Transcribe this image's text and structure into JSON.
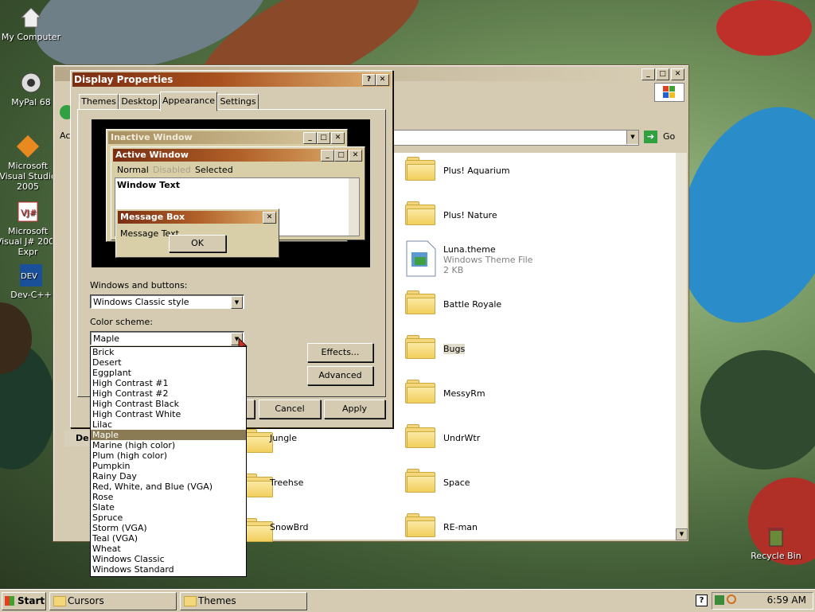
{
  "desktop": {
    "icons": [
      {
        "label": "My Computer"
      },
      {
        "label": "MyPal 68"
      },
      {
        "label": "Microsoft Visual Studio 2005"
      },
      {
        "label": "Microsoft Visual J# 2005 Expr"
      },
      {
        "label": "Dev-C++"
      },
      {
        "label": "Recycle Bin"
      }
    ]
  },
  "explorer": {
    "address_label": "Ac",
    "go_label": "Go",
    "sidebar_header": "De",
    "items": [
      {
        "label": "Plus! Aquarium",
        "type": "folder"
      },
      {
        "label": "Plus! Nature",
        "type": "folder"
      },
      {
        "label": "Luna.theme",
        "type": "file",
        "subtype": "Windows Theme File",
        "size": "2 KB"
      },
      {
        "label": "Battle Royale",
        "type": "folder"
      },
      {
        "label": "Bugs",
        "type": "folder"
      },
      {
        "label": "MessyRm",
        "type": "folder"
      },
      {
        "label": "Jungle",
        "type": "folder"
      },
      {
        "label": "UndrWtr",
        "type": "folder"
      },
      {
        "label": "Treehse",
        "type": "folder"
      },
      {
        "label": "Space",
        "type": "folder"
      },
      {
        "label": "SnowBrd",
        "type": "folder"
      },
      {
        "label": "RE-man",
        "type": "folder"
      }
    ]
  },
  "dialog": {
    "title": "Display Properties",
    "help_btn": "?",
    "close_btn": "✕",
    "tabs": [
      "Themes",
      "Desktop",
      "Appearance",
      "Settings"
    ],
    "active_tab": "Appearance",
    "preview": {
      "inactive_title": "Inactive Window",
      "active_title": "Active Window",
      "menu": [
        "Normal",
        "Disabled",
        "Selected"
      ],
      "window_text": "Window Text",
      "msgbox_title": "Message Box",
      "msgbox_text": "Message Text",
      "ok": "OK"
    },
    "windows_buttons_label": "Windows and buttons:",
    "windows_buttons_value": "Windows Classic style",
    "color_scheme_label": "Color scheme:",
    "color_scheme_value": "Maple",
    "effects_btn": "Effects...",
    "advanced_btn": "Advanced",
    "cancel_btn": "Cancel",
    "apply_btn": "Apply",
    "schemes": [
      "Brick",
      "Desert",
      "Eggplant",
      "High Contrast #1",
      "High Contrast #2",
      "High Contrast Black",
      "High Contrast White",
      "Lilac",
      "Maple",
      "Marine (high color)",
      "Plum (high color)",
      "Pumpkin",
      "Rainy Day",
      "Red, White, and Blue (VGA)",
      "Rose",
      "Slate",
      "Spruce",
      "Storm (VGA)",
      "Teal (VGA)",
      "Wheat",
      "Windows Classic",
      "Windows Standard"
    ],
    "selected_scheme": "Maple"
  },
  "taskbar": {
    "start": "Start",
    "tasks": [
      "Cursors",
      "Themes"
    ],
    "clock": "6:59 AM"
  },
  "colors": {
    "active_title_start": "#7a2e12",
    "active_title_end": "#e0b070",
    "face": "#d4cbb2",
    "selection": "#8a7b55"
  }
}
